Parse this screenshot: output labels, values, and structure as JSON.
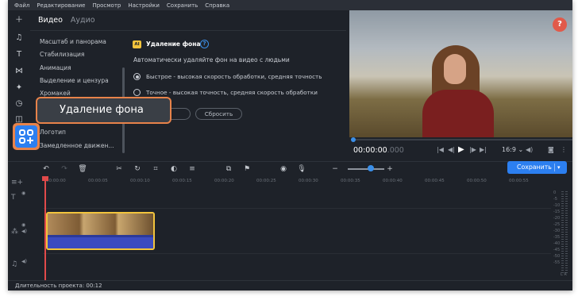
{
  "menubar": {
    "items": [
      "Файл",
      "Редактирование",
      "Просмотр",
      "Настройки",
      "Сохранить",
      "Справка"
    ]
  },
  "tools_sidebar": {
    "icons": [
      "plus-icon",
      "music-note-icon",
      "text-icon",
      "transitions-icon",
      "magic-wand-icon",
      "clock-icon",
      "stickers-icon",
      "more-tools-icon"
    ]
  },
  "tabs": {
    "video": "Видео",
    "audio": "Аудио"
  },
  "filters_list": [
    "Масштаб и панорама",
    "Стабилизация",
    "Анимация",
    "Выделение и цензура",
    "Хромакей",
    "Логотип",
    "Замедленное движен..."
  ],
  "bg_panel": {
    "ai_badge": "AI",
    "title": "Удаление фона",
    "help": "?",
    "description": "Автоматически удаляйте фон на видео с людьми",
    "option_fast": "Быстрое - высокая скорость обработки, средняя точность",
    "option_precise": "Точное - высокая точность, средняя скорость обработки",
    "apply_button": "он",
    "reset_button": "Сбросить"
  },
  "callout": {
    "label": "Удаление фона"
  },
  "preview": {
    "help_badge": "?",
    "timecode": "00:00:00",
    "timecode_ms": ".000",
    "aspect_ratio": "16:9"
  },
  "toolbar": {
    "save_label": "Сохранить"
  },
  "ruler": {
    "ticks": [
      "00:00:00",
      "00:00:05",
      "00:00:10",
      "00:00:15",
      "00:00:20",
      "00:00:25",
      "00:00:30",
      "00:00:35",
      "00:00:40",
      "00:00:45",
      "00:00:50",
      "00:00:55"
    ]
  },
  "meter": {
    "labels": [
      "0",
      "-5",
      "-10",
      "-15",
      "-20",
      "-25",
      "-30",
      "-35",
      "-40",
      "-45",
      "-50",
      "-55"
    ],
    "channels": "L R"
  },
  "status": {
    "duration": "Длительность проекта: 00:12"
  },
  "colors": {
    "accent_blue": "#2c7ff0",
    "highlight_orange": "#e8834a",
    "clip_yellow": "#f2c43d",
    "playhead_red": "#e14a4a",
    "help_red": "#e15a4a"
  }
}
